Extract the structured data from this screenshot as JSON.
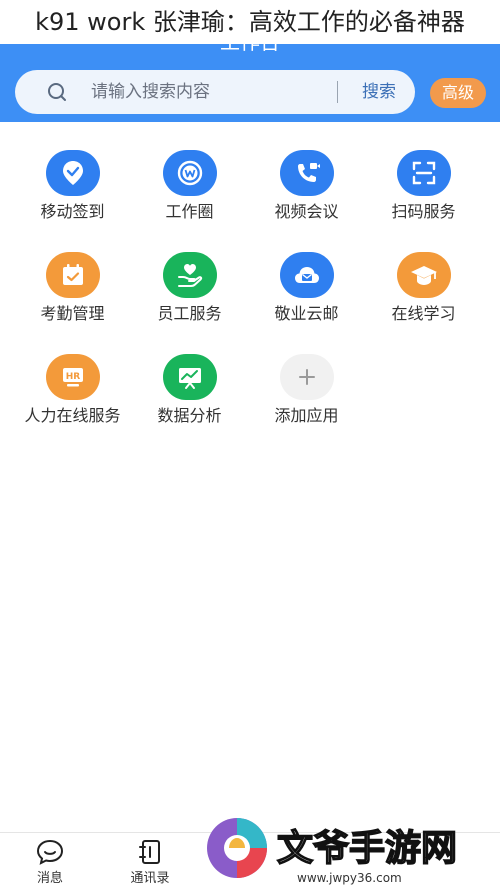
{
  "caption": "k91 work 张津瑜：高效工作的必备神器",
  "header": {
    "title": "工作台",
    "search_placeholder": "请输入搜索内容",
    "search_button": "搜索",
    "advanced_button": "高级"
  },
  "apps": [
    {
      "label": "移动签到",
      "icon": "check-in-icon",
      "color": "#2f7ff0"
    },
    {
      "label": "工作圈",
      "icon": "work-circle-icon",
      "color": "#2f7ff0"
    },
    {
      "label": "视频会议",
      "icon": "video-meeting-icon",
      "color": "#2f7ff0"
    },
    {
      "label": "扫码服务",
      "icon": "scan-icon",
      "color": "#2f7ff0"
    },
    {
      "label": "考勤管理",
      "icon": "attendance-icon",
      "color": "#f39a3a"
    },
    {
      "label": "员工服务",
      "icon": "employee-service-icon",
      "color": "#19b45b"
    },
    {
      "label": "敬业云邮",
      "icon": "cloud-mail-icon",
      "color": "#2f7ff0"
    },
    {
      "label": "在线学习",
      "icon": "graduation-cap-icon",
      "color": "#f39a3a"
    },
    {
      "label": "人力在线服务",
      "icon": "hr-icon",
      "color": "#f39a3a"
    },
    {
      "label": "数据分析",
      "icon": "data-analysis-icon",
      "color": "#19b45b"
    },
    {
      "label": "添加应用",
      "icon": "plus-icon",
      "color": "#f1f1f1"
    }
  ],
  "bottom_nav": [
    {
      "label": "消息",
      "icon": "message-icon"
    },
    {
      "label": "通讯录",
      "icon": "contacts-icon"
    }
  ],
  "watermark": {
    "text": "文爷手游网",
    "url": "www.jwpy36.com"
  }
}
